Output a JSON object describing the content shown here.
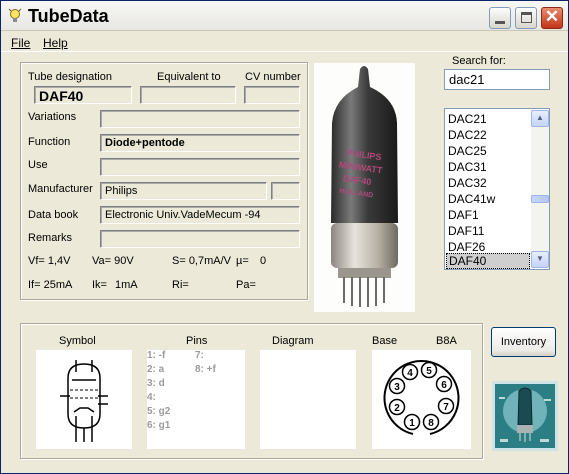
{
  "window": {
    "title": "TubeData"
  },
  "menu": {
    "file": "File",
    "help": "Help"
  },
  "details": {
    "designation_label": "Tube designation",
    "equivalent_label": "Equivalent to",
    "cv_label": "CV number",
    "designation": "DAF40",
    "equivalent": "",
    "cv_number": "",
    "variations_label": "Variations",
    "variations": "",
    "function_label": "Function",
    "function": "Diode+pentode",
    "use_label": "Use",
    "use": "",
    "manufacturer_label": "Manufacturer",
    "manufacturer": "Philips",
    "manufacturer_code": "",
    "databook_label": "Data book",
    "databook": "Electronic Univ.VadeMecum -94",
    "remarks_label": "Remarks",
    "remarks": "",
    "vf": "Vf= 1,4V",
    "va": "Va= 90V",
    "s": "S= 0,7mA/V",
    "mu": "µ=",
    "mu_value": "0",
    "if": "If= 25mA",
    "ik": "Ik=",
    "ik_value": "1mA",
    "ri": "Ri=",
    "pa": "Pa="
  },
  "photo": {
    "print_lines": [
      "PHILIPS",
      "MINIWATT",
      "DAF40",
      "HOLLAND"
    ]
  },
  "search": {
    "label": "Search for:",
    "value": "dac21"
  },
  "tube_list": {
    "items": [
      "DAC21",
      "DAC22",
      "DAC25",
      "DAC31",
      "DAC32",
      "DAC41w",
      "DAF1",
      "DAF11",
      "DAF26",
      "DAF40"
    ],
    "selected": "DAF40"
  },
  "bottom": {
    "symbol_label": "Symbol",
    "pins_label": "Pins",
    "diagram_label": "Diagram",
    "base_label": "Base",
    "base_type": "B8A",
    "pins_col1": [
      "1: -f",
      "2: a",
      "3: d",
      "4:",
      "5: g2",
      "6: g1"
    ],
    "pins_col2": [
      "7:",
      "8: +f"
    ],
    "base_pins": [
      "1",
      "2",
      "3",
      "4",
      "5",
      "6",
      "7",
      "8"
    ]
  },
  "inventory": {
    "label": "Inventory"
  },
  "colors": {
    "title_bar": "#f2f1ec",
    "close_button": "#c9381c",
    "selection": "#cfcfcf",
    "pin_text": "#9a9a9a",
    "logo_bg": "#1f6f73"
  },
  "icons": [
    "bulb-icon",
    "minimize-icon",
    "maximize-icon",
    "close-icon",
    "scroll-up-icon",
    "scroll-down-icon",
    "tube-symbol-icon",
    "base-pin-diagram-icon",
    "logo-icon"
  ]
}
